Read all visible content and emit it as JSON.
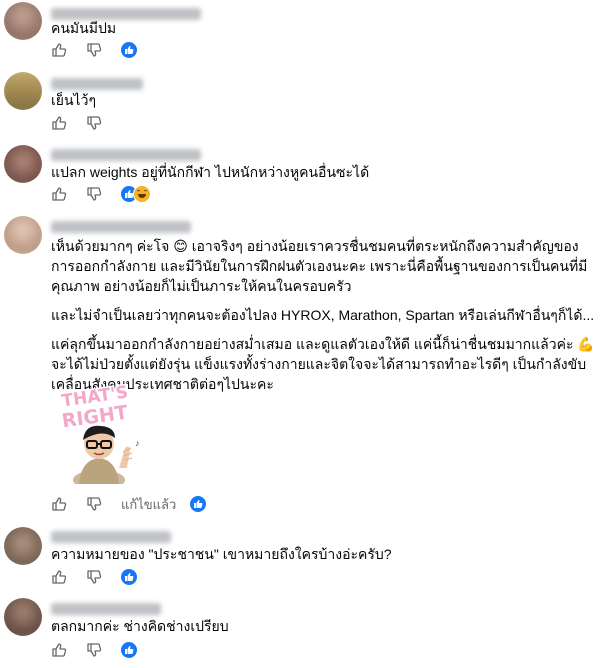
{
  "comments": [
    {
      "text": [
        "คนมันมีปม"
      ],
      "reaction": "like"
    },
    {
      "text": [
        "เย็นไว้ๆ"
      ],
      "reaction": ""
    },
    {
      "text": [
        "แปลก weights อยู่ที่นักกีฬา ไปหนักหว่างหูคนอื่นซะได้"
      ],
      "reaction": "like-haha"
    },
    {
      "text": [
        "เห็นด้วยมากๆ ค่ะโจ 😊 เอาจริงๆ อย่างน้อยเราควรชื่นชมคนที่ตระหนักถึงความสำคัญของการออกกำลังกาย และมีวินัยในการฝึกฝนตัวเองนะคะ เพราะนี่คือพื้นฐานของการเป็นคนที่มีคุณภาพ อย่างน้อยก็ไม่เป็นภาระให้คนในครอบครัว",
        "และไม่จำเป็นเลยว่าทุกคนจะต้องไปลง HYROX, Marathon, Spartan หรือเล่นกีฬาอื่นๆก็ได้...",
        "แค่ลุกขึ้นมาออกกำลังกายอย่างสม่ำเสมอ และดูแลตัวเองให้ดี แค่นี้ก็น่าชื่นชมมากแล้วค่ะ 💪 จะได้ไม่ป่วยตั้งแต่ยังรุ่น แข็งแรงทั้งร่างกายและจิตใจจะได้สามารถทำอะไรดีๆ เป็นกำลังขับเคลื่อนสังคมประเทศชาติต่อๆไปนะคะ"
      ],
      "sticker_text": "THAT'S RIGHT",
      "edited_label": "แก้ไขแล้ว",
      "reaction": "like"
    },
    {
      "text": [
        "ความหมายของ \"ประชาชน\" เขาหมายถึงใครบ้างอ่ะครับ?"
      ],
      "reaction": "like"
    },
    {
      "text": [
        "ตลกมากค่ะ ช่างคิดช่างเปรียบ"
      ],
      "reaction": "like"
    }
  ],
  "colors": {
    "like_blue": "#1877f2",
    "muted": "#65676b",
    "haha_yellow": "#f7b125"
  },
  "icons": [
    "thumbs-up-icon",
    "thumbs-down-icon",
    "like-reaction-icon",
    "haha-reaction-icon"
  ]
}
